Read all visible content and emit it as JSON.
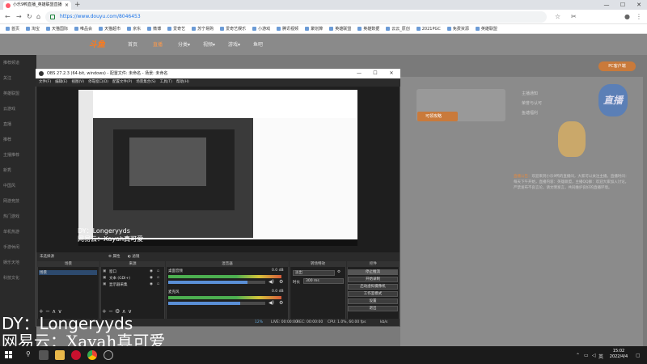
{
  "browser": {
    "tab_title": "小乐9鸭直播_英雄联盟直播",
    "tab_close": "×",
    "new_tab": "+",
    "url": "https://www.douyu.com/8046453",
    "bookmarks": [
      "首页",
      "淘宝",
      "天猫国际",
      "唯品会",
      "天猫超市",
      "京东",
      "微博",
      "爱奇艺",
      "苏宁易购",
      "爱奇艺娱乐",
      "小游戏",
      "腾讯视频",
      "聚划算",
      "英雄联盟",
      "英雄数据",
      "云云_原创",
      "2021PGC",
      "免费资源",
      "英雄联盟"
    ]
  },
  "site": {
    "logo": "斗鱼",
    "nav": [
      "首页",
      "直播",
      "分类▾",
      "视频▾",
      "游戏▾",
      "鱼吧"
    ],
    "sidebar": [
      "推荐频道",
      "关注",
      "英雄联盟",
      "云游戏",
      "直播",
      "推荐",
      "主播推荐",
      "新秀",
      "中国风",
      "网游竞技",
      "热门游戏",
      "单机热游",
      "手游休闲",
      "娱乐天地",
      "科技文化"
    ],
    "pc_button": "PC客户端",
    "follow_label": "可领攻略",
    "side_badge": "直播",
    "right_links": [
      "主播通知",
      "荣誉与认可",
      "鱼塘福利"
    ],
    "notice_head": "直播公告：",
    "notice_text": "欢迎来到小乐9鸭的直播间，大家可以关注主播。直播时间：每天下午开始，直播内容：英雄联盟，主播QQ群：欢迎大家加入讨论。严禁发布不良言论，请文明发言，共同维护良好的直播环境。"
  },
  "obs": {
    "title": "OBS 27.2.3 (64-bit, windows) - 配置文件: 未命名 - 场景: 未命名",
    "menu": [
      "文件(F)",
      "编辑(E)",
      "视图(V)",
      "停靠窗口(D)",
      "配置文件(P)",
      "场景集合(S)",
      "工具(T)",
      "帮助(H)"
    ],
    "scene_info": "未选择源",
    "docks": {
      "scenes": {
        "title": "场景",
        "items": [
          "场景"
        ]
      },
      "sources": {
        "title": "来源",
        "items": [
          "窗口",
          "文本 (GDI+)",
          "显示器采集"
        ]
      },
      "mixer": {
        "title": "混音器",
        "channels": [
          {
            "name": "桌面音频",
            "db": "0.0 dB",
            "level": 0.82
          },
          {
            "name": "麦克风",
            "db": "0.0 dB",
            "level": 0.74
          }
        ]
      },
      "transitions": {
        "title": "转场特效",
        "type": "淡出",
        "duration_label": "时长",
        "duration": "300 ms"
      },
      "controls": {
        "title": "控件",
        "buttons": [
          "停止推流",
          "开始录制",
          "启动虚拟摄像机",
          "工作室模式",
          "设置",
          "退出"
        ]
      }
    },
    "status": {
      "live": "LIVE: 00:00:00",
      "rec": "REC: 00:00:00",
      "cpu": "CPU: 1.0%, 60.00 fps",
      "kbps": "kb/s",
      "dropped": "12%"
    }
  },
  "overlay": {
    "line1": "DY：Longeryyds",
    "line2": "网易云：Xayah真可爱"
  },
  "taskbar": {
    "time": "15:02",
    "date": "2022/4/4",
    "lang": "英"
  },
  "colors": {
    "accent_orange": "#ff7a1a",
    "obs_bg": "#2b2b2b",
    "url_blue": "#1a73e8"
  }
}
